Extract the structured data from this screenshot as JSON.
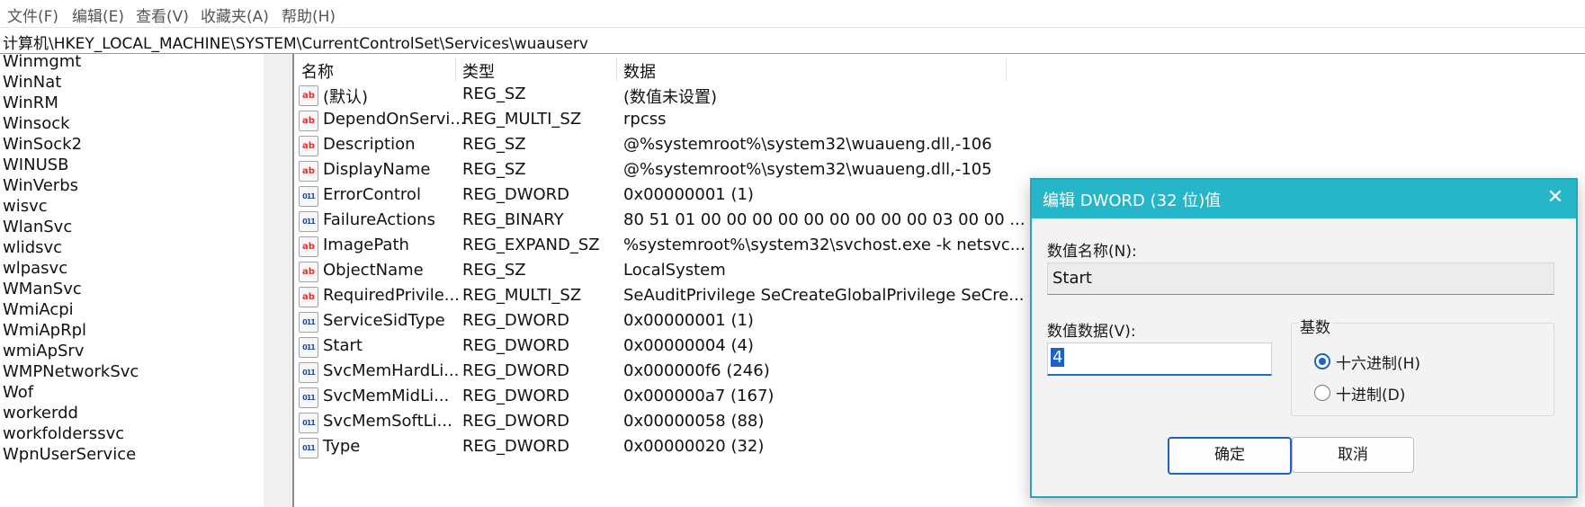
{
  "menu": [
    "文件(F)",
    "编辑(E)",
    "查看(V)",
    "收藏夹(A)",
    "帮助(H)"
  ],
  "address": "计算机\\HKEY_LOCAL_MACHINE\\SYSTEM\\CurrentControlSet\\Services\\wuauserv",
  "tree": [
    "Winmgmt",
    "WinNat",
    "WinRM",
    "Winsock",
    "WinSock2",
    "WINUSB",
    "WinVerbs",
    "wisvc",
    "WlanSvc",
    "wlidsvc",
    "wlpasvc",
    "WManSvc",
    "WmiAcpi",
    "WmiApRpl",
    "wmiApSrv",
    "WMPNetworkSvc",
    "Wof",
    "workerdd",
    "workfolderssvc",
    "WpnUserService"
  ],
  "columns": {
    "name": "名称",
    "type": "类型",
    "data": "数据"
  },
  "values": [
    {
      "icon": "string-value-icon",
      "name": "(默认)",
      "type": "REG_SZ",
      "data": "(数值未设置)"
    },
    {
      "icon": "string-value-icon",
      "name": "DependOnServi...",
      "type": "REG_MULTI_SZ",
      "data": "rpcss"
    },
    {
      "icon": "string-value-icon",
      "name": "Description",
      "type": "REG_SZ",
      "data": "@%systemroot%\\system32\\wuaueng.dll,-106"
    },
    {
      "icon": "string-value-icon",
      "name": "DisplayName",
      "type": "REG_SZ",
      "data": "@%systemroot%\\system32\\wuaueng.dll,-105"
    },
    {
      "icon": "binary-value-icon",
      "name": "ErrorControl",
      "type": "REG_DWORD",
      "data": "0x00000001 (1)"
    },
    {
      "icon": "binary-value-icon",
      "name": "FailureActions",
      "type": "REG_BINARY",
      "data": "80 51 01 00 00 00 00 00 00 00 00 00 03 00 00 ..."
    },
    {
      "icon": "string-value-icon",
      "name": "ImagePath",
      "type": "REG_EXPAND_SZ",
      "data": "%systemroot%\\system32\\svchost.exe -k netsvc..."
    },
    {
      "icon": "string-value-icon",
      "name": "ObjectName",
      "type": "REG_SZ",
      "data": "LocalSystem"
    },
    {
      "icon": "string-value-icon",
      "name": "RequiredPrivile...",
      "type": "REG_MULTI_SZ",
      "data": "SeAuditPrivilege SeCreateGlobalPrivilege SeCre..."
    },
    {
      "icon": "binary-value-icon",
      "name": "ServiceSidType",
      "type": "REG_DWORD",
      "data": "0x00000001 (1)"
    },
    {
      "icon": "binary-value-icon",
      "name": "Start",
      "type": "REG_DWORD",
      "data": "0x00000004 (4)"
    },
    {
      "icon": "binary-value-icon",
      "name": "SvcMemHardLi...",
      "type": "REG_DWORD",
      "data": "0x000000f6 (246)"
    },
    {
      "icon": "binary-value-icon",
      "name": "SvcMemMidLi...",
      "type": "REG_DWORD",
      "data": "0x000000a7 (167)"
    },
    {
      "icon": "binary-value-icon",
      "name": "SvcMemSoftLi...",
      "type": "REG_DWORD",
      "data": "0x00000058 (88)"
    },
    {
      "icon": "binary-value-icon",
      "name": "Type",
      "type": "REG_DWORD",
      "data": "0x00000020 (32)"
    }
  ],
  "dialog": {
    "title": "编辑 DWORD (32 位)值",
    "close": "✕",
    "name_label": "数值名称(N):",
    "name_value": "Start",
    "data_label": "数值数据(V):",
    "data_value": "4",
    "base_label": "基数",
    "radio_hex": "十六进制(H)",
    "radio_dec": "十进制(D)",
    "ok": "确定",
    "cancel": "取消",
    "accent": "#26b6c9"
  }
}
